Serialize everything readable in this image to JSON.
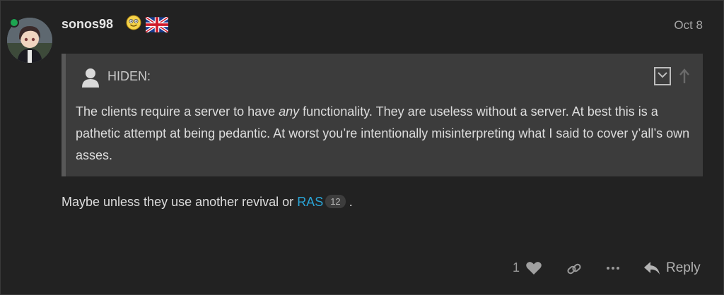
{
  "post": {
    "username": "sonos98",
    "date": "Oct 8",
    "body_prefix": "Maybe unless they use another revival or ",
    "link_text": "RAS",
    "link_clicks": "12",
    "body_suffix": "."
  },
  "quote": {
    "username": "HIDEN:",
    "text_before": "The clients require a server to have ",
    "text_emph": "any",
    "text_after": " functionality. They are useless without a server. At best this is a pathetic attempt at being pedantic. At worst you’re intentionally misinterpreting what I said to cover y’all’s own asses."
  },
  "actions": {
    "like_count": "1",
    "reply_label": "Reply"
  },
  "colors": {
    "background": "#222222",
    "quote_background": "#3c3c3c",
    "link": "#2aa4d6",
    "online": "#1ca551"
  },
  "icons": [
    "online-status-dot",
    "smiley-emoji-icon",
    "uk-flag-icon",
    "user-icon",
    "expand-quote-icon",
    "arrow-up-icon",
    "heart-icon",
    "link-icon",
    "more-icon",
    "reply-icon"
  ]
}
